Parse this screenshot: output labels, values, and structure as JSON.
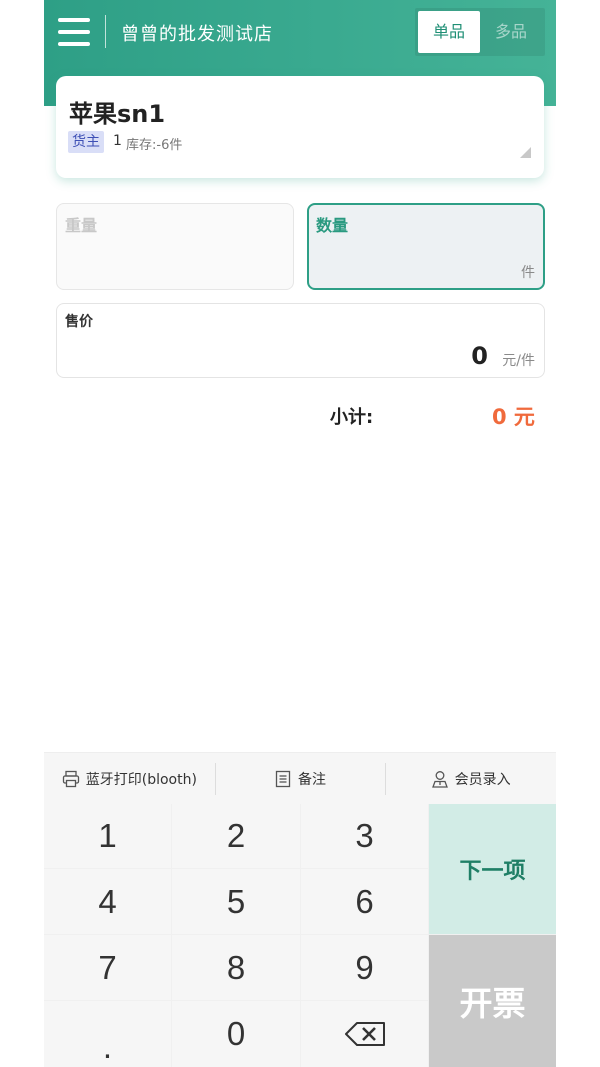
{
  "header": {
    "store_name": "曾曾的批发测试店",
    "mode_tabs": [
      {
        "label": "单品",
        "active": true
      },
      {
        "label": "多品",
        "active": false
      }
    ]
  },
  "product": {
    "name": "苹果sn1",
    "owner_badge": "货主",
    "owner_count": "1",
    "stock_text": "库存:-6件"
  },
  "fields": {
    "weight_label": "重量",
    "quantity_label": "数量",
    "quantity_unit": "件",
    "price_label": "售价",
    "price_value": "0",
    "price_unit": "元/件"
  },
  "subtotal": {
    "label": "小计:",
    "value": "0 元"
  },
  "toolbar": {
    "print_label": "蓝牙打印(blooth)",
    "note_label": "备注",
    "member_label": "会员录入"
  },
  "keypad": {
    "keys": [
      "1",
      "2",
      "3",
      "4",
      "5",
      "6",
      "7",
      "8",
      "9",
      ".",
      "0"
    ],
    "backspace_icon": "backspace-icon",
    "next_label": "下一项",
    "invoice_label": "开票"
  },
  "colors": {
    "brand": "#2e9f86",
    "accent_orange": "#f06a3c",
    "next_bg": "#d2ece6",
    "invoice_bg": "#c9c9c9"
  }
}
